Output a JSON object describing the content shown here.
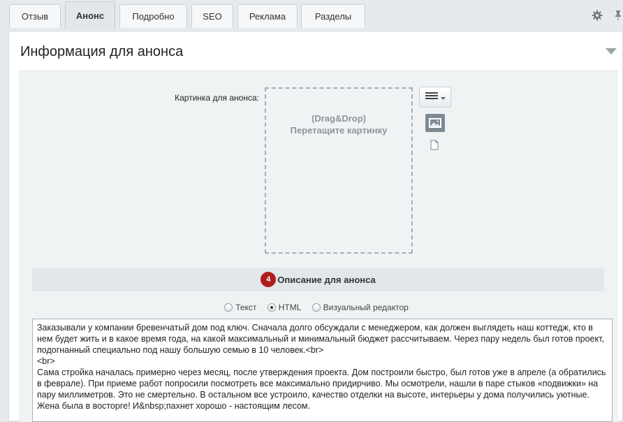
{
  "tabs": [
    {
      "label": "Отзыв",
      "active": false
    },
    {
      "label": "Анонс",
      "active": true
    },
    {
      "label": "Подробно",
      "active": false
    },
    {
      "label": "SEO",
      "active": false
    },
    {
      "label": "Реклама",
      "active": false
    },
    {
      "label": "Разделы",
      "active": false
    }
  ],
  "icons": {
    "settings": "gear-icon",
    "pin": "pin-icon",
    "collapse": "chevron-down-icon",
    "menu": "hamburger-menu-icon",
    "image": "image-icon",
    "file": "file-icon"
  },
  "panel": {
    "title": "Информация для анонса"
  },
  "picture": {
    "label": "Картинка для анонса:",
    "dropzone_line1": "(Drag&Drop)",
    "dropzone_line2": "Перетащите картинку"
  },
  "description": {
    "badge": "4",
    "title": "Описание для анонса",
    "modes": [
      {
        "label": "Текст",
        "checked": false
      },
      {
        "label": "HTML",
        "checked": true
      },
      {
        "label": "Визуальный редактор",
        "checked": false
      }
    ],
    "content": "Заказывали у компании бревенчатый дом под ключ. Сначала долго обсуждали с менеджером, как должен выглядеть наш коттедж, кто в нем будет жить и в какое время года, на какой максимальный и минимальный бюджет рассчитываем. Через пару недель был готов проект, подогнанный специально под нашу большую семью в 10 человек.<br>\n<br>\nСама стройка началась примерно через месяц, после утверждения проекта. Дом построили быстро, был готов уже в апреле (а обратились в феврале). При приеме работ попросили посмотреть все максимально придирчиво. Мы осмотрели, нашли в паре стыков «подвижки» на пару миллиметров. Это не смертельно. В остальном все устроило, качество отделки на высоте, интерьеры у дома получились уютные. Жена была в восторге! И&nbsp;пахнет хорошо - настоящим лесом."
  },
  "colors": {
    "badge": "#b01c1c",
    "active_tab": "#e2e7ea",
    "section_bar": "#e2e7e9"
  }
}
